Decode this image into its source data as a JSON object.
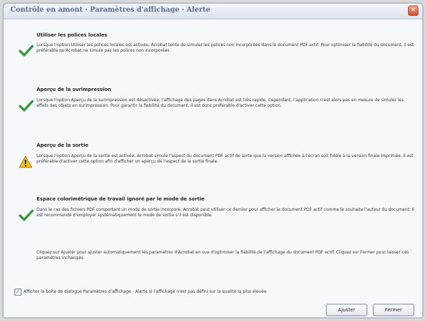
{
  "window": {
    "title": "Contrôle en amont · Paramètres d'affichage · Alerte",
    "close_label": "✕"
  },
  "sections": [
    {
      "icon": "green-check-icon",
      "title": "Utiliser les polices locales",
      "text": "Lorsque l'option Utiliser les polices locales est activée, Acrobat tente de simuler les polices non incorporées dans le document PDF actif. Pour optimiser la fiabilité du document, il est préférable qu'Acrobat ne simule pas les polices non incorporées."
    },
    {
      "icon": "green-check-icon",
      "title": "Aperçu de la surimpression",
      "text": "Lorsque l'option Aperçu de la surimpression est désactivée, l'affichage des pages dans Acrobat est très rapide. Cependant, l'application n'est alors pas en mesure de simuler les effets des objets en surimpression. Pour garantir la fiabilité du document, il est donc préférable d'activer cette option."
    },
    {
      "icon": "warning-triangle-icon",
      "title": "Aperçu de la sortie",
      "text": "Lorsque l'option Aperçu de la sortie est activée, Acrobat simule l'aspect du document PDF actif de sorte que la version affichée à l'écran soit fidèle à la version finale imprimée. Il est préférable d'activer cette option afin d'afficher un aperçu de l'aspect de la sortie finale."
    },
    {
      "icon": "green-check-icon",
      "title": "Espace colorimétrique de travail ignoré par le mode de sortie",
      "text": "Dans le cas des fichiers PDF comportant un mode de sortie incorporé, Acrobat peut utiliser ce dernier pour afficher le document PDF actif comme le souhaite l'auteur du document. Il est recommandé d'employer systématiquement le mode de sortie s'il est disponible."
    }
  ],
  "footer_text": "Cliquez sur Ajuster pour ajuster automatiquement les paramètres d'Acrobat en vue d'optimiser la fiabilité de l'affichage du document PDF actif. Cliquez sur Fermer pour laisser ces paramètres inchangés.",
  "checkbox": {
    "checked": true,
    "mark": "✓",
    "label": "Afficher la boîte de dialogue Paramètres d'affichage - Alerte si l'affichage n'est pas défini sur la qualité la plus élevée"
  },
  "buttons": {
    "adjust": "Ajuster",
    "close": "Fermer"
  },
  "colors": {
    "check_green": "#2f9a3a",
    "warning_yellow": "#f2c21b"
  }
}
